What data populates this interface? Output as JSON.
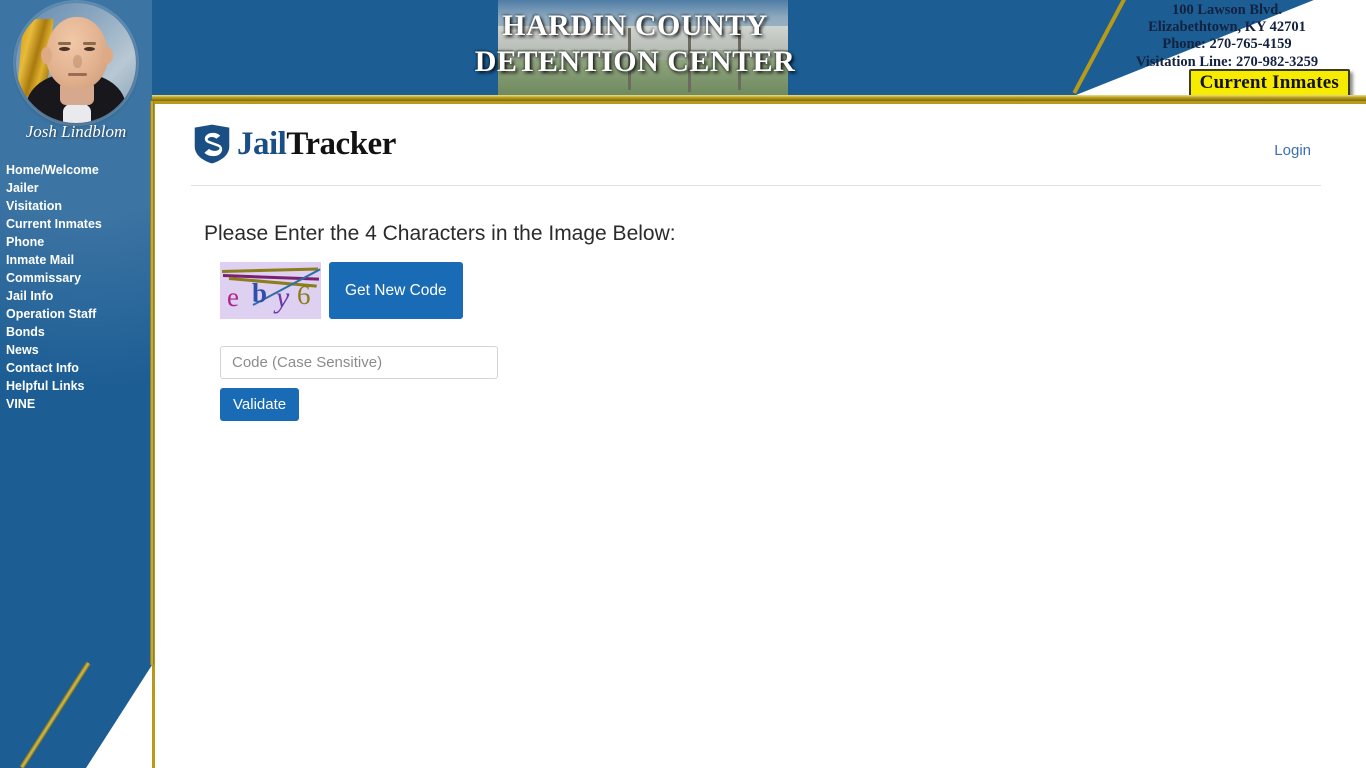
{
  "header": {
    "facility_title": "HARDIN COUNTY\nDETENTION CENTER",
    "address_line1": "100 Lawson Blvd.",
    "address_line2": "Elizabethtown, KY 42701",
    "phone": "Phone: 270-765-4159",
    "visitation": "Visitation Line: 270-982-3259",
    "current_inmates_button": "Current Inmates"
  },
  "sidebar": {
    "officer_name": "Josh Lindblom",
    "items": [
      {
        "label": "Home/Welcome"
      },
      {
        "label": "Jailer"
      },
      {
        "label": "Visitation"
      },
      {
        "label": "Current Inmates"
      },
      {
        "label": "Phone"
      },
      {
        "label": "Inmate Mail"
      },
      {
        "label": "Commissary"
      },
      {
        "label": "Jail Info"
      },
      {
        "label": "Operation Staff"
      },
      {
        "label": "Bonds"
      },
      {
        "label": "News"
      },
      {
        "label": "Contact Info"
      },
      {
        "label": "Helpful Links"
      },
      {
        "label": "VINE"
      }
    ]
  },
  "brand": {
    "name_part1": "Jail",
    "name_part2": "Tracker",
    "logo_icon": "shield-icon",
    "login_label": "Login"
  },
  "main": {
    "prompt": "Please Enter the 4 Characters in the Image Below:",
    "captcha": {
      "characters": [
        {
          "char": "e",
          "color": "#b0248c"
        },
        {
          "char": "b",
          "color": "#2f4fa8"
        },
        {
          "char": "y",
          "color": "#6a3aa8"
        },
        {
          "char": "6",
          "color": "#8a7d1a"
        }
      ],
      "background_color": "#ddd0f0"
    },
    "get_new_code_label": "Get New Code",
    "code_input_placeholder": "Code (Case Sensitive)",
    "code_input_value": "",
    "validate_label": "Validate"
  },
  "colors": {
    "brand_blue": "#1c5d94",
    "gold": "#b89a1a",
    "button_blue": "#1a6bb5",
    "highlight_yellow": "#f7eb00",
    "link_blue": "#3a6fb5"
  }
}
